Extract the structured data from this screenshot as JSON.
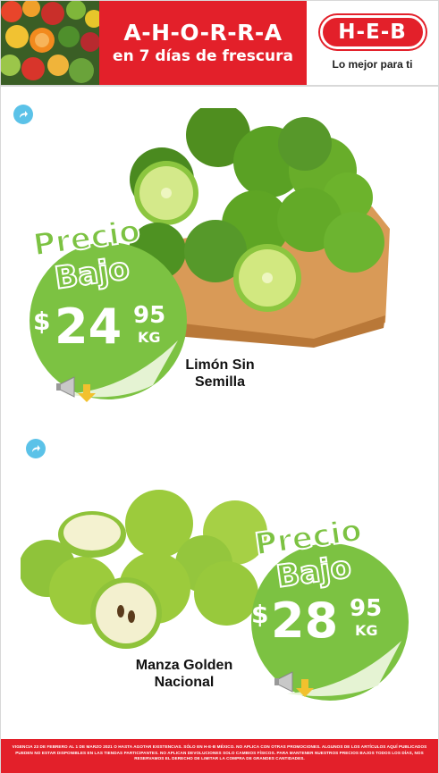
{
  "header": {
    "banner_title": "A-H-O-R-R-A",
    "banner_subtitle": "en 7 días de frescura",
    "logo_text": "H-E-B",
    "tagline": "Lo mejor para ti"
  },
  "products": [
    {
      "badge_line1": "Precio",
      "badge_line2": "Bajo",
      "currency": "$",
      "price_int": "24",
      "price_dec": "95",
      "unit": "KG",
      "name_line1": "Limón Sin",
      "name_line2": "Semilla"
    },
    {
      "badge_line1": "Precio",
      "badge_line2": "Bajo",
      "currency": "$",
      "price_int": "28",
      "price_dec": "95",
      "unit": "KG",
      "name_line1": "Manza Golden",
      "name_line2": "Nacional"
    }
  ],
  "footer": {
    "legal_text": "VIGENCIA 23 DE FEBRERO AL 1 DE MARZO 2021 O HASTA AGOTAR EXISTENCIAS. SÓLO EN H-E-B MÉXICO. NO APLICA CON OTRAS PROMOCIONES. ALGUNOS DE LOS ARTÍCULOS AQUÍ PUBLICADOS PUEDEN NO ESTAR DISPONIBLES EN LAS TIENDAS PARTICIPANTES. NO APLICAN DEVOLUCIONES SOLO CAMBIOS FÍSICOS. PARA MANTENER NUESTROS PRECIOS BAJOS TODOS LOS DÍAS, NOS RESERVAMOS EL DERECHO DE LIMITAR LA COMPRA DE GRANDES CANTIDADES."
  },
  "colors": {
    "brand_red": "#e3202a",
    "badge_green": "#7cc242",
    "share_blue": "#5bc2e8"
  },
  "icons": [
    "share-icon",
    "megaphone-icon",
    "arrow-down-icon"
  ]
}
